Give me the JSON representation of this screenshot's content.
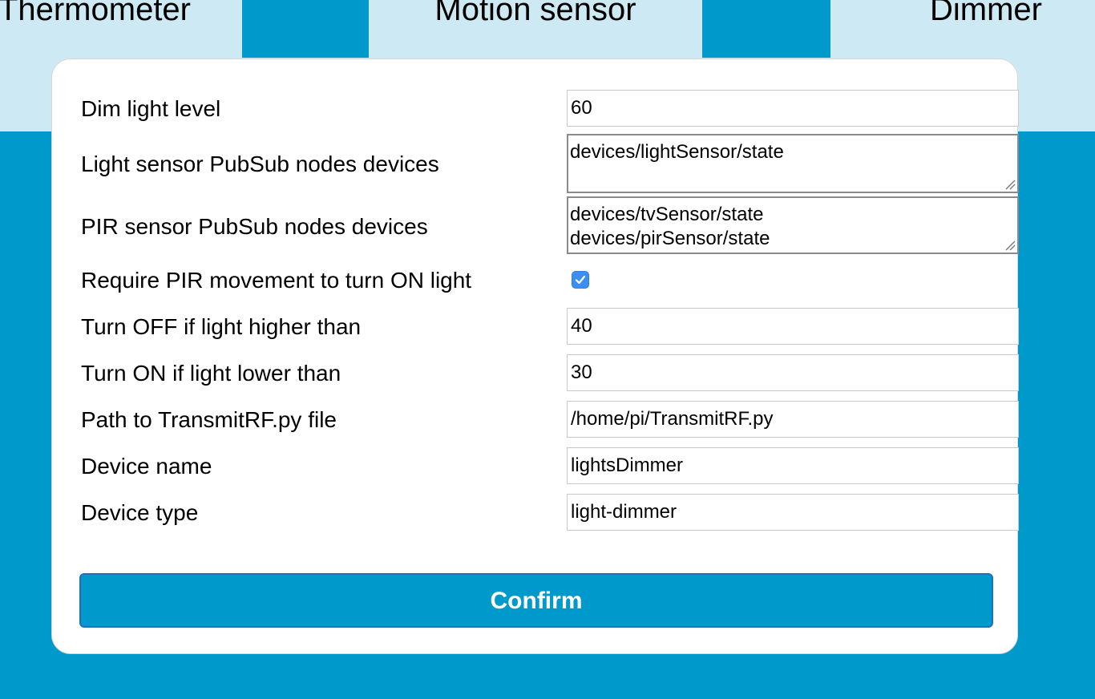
{
  "tabs": [
    {
      "label": "Thermometer"
    },
    {
      "label": "Motion sensor"
    },
    {
      "label": "Dimmer"
    }
  ],
  "form": {
    "dim_light_level": {
      "label": "Dim light level",
      "value": "60"
    },
    "light_sensor_nodes": {
      "label": "Light sensor PubSub nodes devices",
      "value": "devices/lightSensor/state"
    },
    "pir_sensor_nodes": {
      "label": "PIR sensor PubSub nodes devices",
      "value": "devices/tvSensor/state\ndevices/pirSensor/state"
    },
    "require_pir": {
      "label": "Require PIR movement to turn ON light",
      "checked": true
    },
    "turn_off_threshold": {
      "label": "Turn OFF if light higher than",
      "value": "40"
    },
    "turn_on_threshold": {
      "label": "Turn ON if light lower than",
      "value": "30"
    },
    "transmit_path": {
      "label": "Path to TransmitRF.py file",
      "value": "/home/pi/TransmitRF.py"
    },
    "device_name": {
      "label": "Device name",
      "value": "lightsDimmer"
    },
    "device_type": {
      "label": "Device type",
      "value": "light-dimmer"
    }
  },
  "confirm_label": "Confirm",
  "icons": {
    "checkbox": "checkmark-icon",
    "textarea_resize": "resize-grip-icon"
  },
  "colors": {
    "accent": "#0099cc",
    "tab_background": "#cdeaf4",
    "checkbox": "#3b8ff3"
  }
}
